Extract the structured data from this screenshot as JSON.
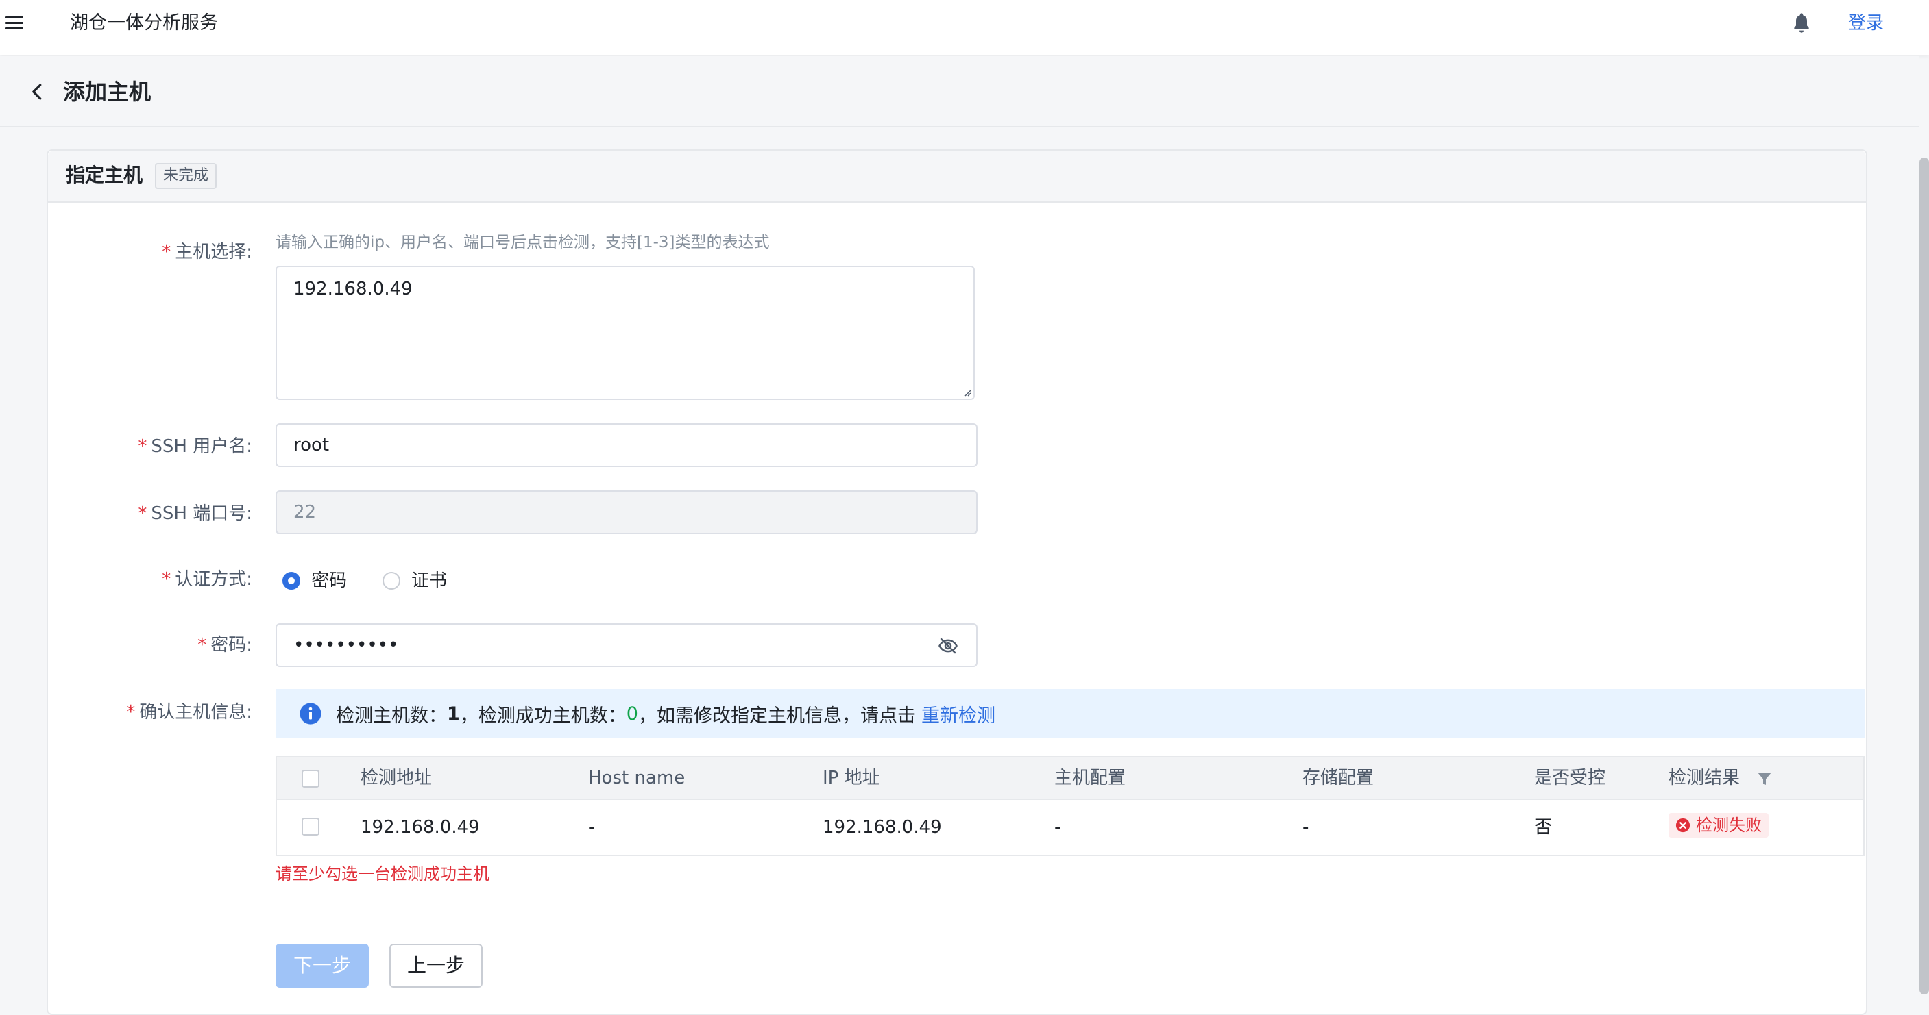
{
  "header": {
    "app_title": "湖仓一体分析服务",
    "login_label": "登录"
  },
  "page": {
    "title": "添加主机"
  },
  "card": {
    "title": "指定主机",
    "status": "未完成"
  },
  "form": {
    "host_label": "主机选择:",
    "host_hint": "请输入正确的ip、用户名、端口号后点击检测，支持[1-3]类型的表达式",
    "host_value": "192.168.0.49",
    "ssh_user_label": "SSH 用户名:",
    "ssh_user_value": "root",
    "ssh_port_label": "SSH 端口号:",
    "ssh_port_value": "22",
    "auth_label": "认证方式:",
    "auth_options": [
      {
        "label": "密码",
        "selected": true
      },
      {
        "label": "证书",
        "selected": false
      }
    ],
    "password_label": "密码:",
    "password_mask": "••••••••••",
    "confirm_label": "确认主机信息:"
  },
  "alert": {
    "text1": "检测主机数：",
    "detected_count": "1",
    "text2": "，检测成功主机数：",
    "success_count": "0",
    "text3": "，如需修改指定主机信息，请点击",
    "link": "重新检测"
  },
  "table": {
    "headers": [
      "检测地址",
      "Host name",
      "IP 地址",
      "主机配置",
      "存储配置",
      "是否受控",
      "检测结果"
    ],
    "rows": [
      {
        "address": "192.168.0.49",
        "hostname": "-",
        "ip": "192.168.0.49",
        "host_config": "-",
        "storage_config": "-",
        "controlled": "否",
        "result": "检测失败"
      }
    ]
  },
  "validation_error": "请至少勾选一台检测成功主机",
  "buttons": {
    "next": "下一步",
    "prev": "上一步"
  },
  "colors": {
    "primary": "#2f6fe0",
    "error": "#e0303a",
    "success": "#10a34a",
    "disabled_primary": "#9fc3f7"
  }
}
